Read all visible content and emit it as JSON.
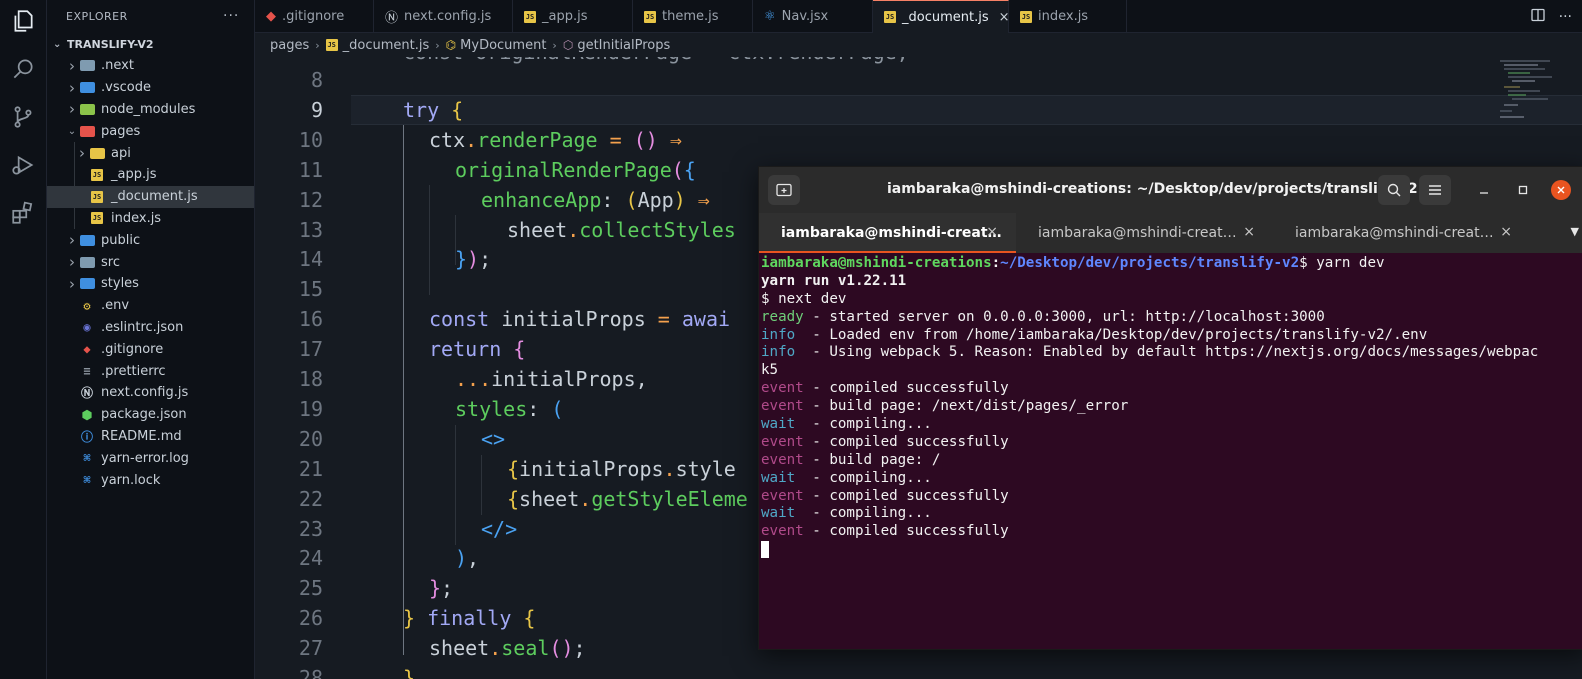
{
  "activity_bar": {
    "icons": [
      "explorer-icon",
      "search-icon",
      "source-control-icon",
      "run-debug-icon",
      "extensions-icon"
    ]
  },
  "sidebar": {
    "title": "EXPLORER",
    "more": "···",
    "project": "TRANSLIFY-V2",
    "items": [
      {
        "label": ".next",
        "type": "folder",
        "color": "#7f9bb0",
        "depth": 0
      },
      {
        "label": ".vscode",
        "type": "folder",
        "color": "#3f8fe0",
        "depth": 0
      },
      {
        "label": "node_modules",
        "type": "folder",
        "color": "#8bc34a",
        "depth": 0
      },
      {
        "label": "pages",
        "type": "folder-open",
        "color": "#e5534b",
        "depth": 0
      },
      {
        "label": "api",
        "type": "folder",
        "color": "#e7c547",
        "depth": 1
      },
      {
        "label": "_app.js",
        "type": "js",
        "depth": 1
      },
      {
        "label": "_document.js",
        "type": "js",
        "depth": 1,
        "selected": true
      },
      {
        "label": "index.js",
        "type": "js",
        "depth": 1
      },
      {
        "label": "public",
        "type": "folder",
        "color": "#3f8fe0",
        "depth": 0
      },
      {
        "label": "src",
        "type": "folder",
        "color": "#7f9bb0",
        "depth": 0
      },
      {
        "label": "styles",
        "type": "folder",
        "color": "#3f8fe0",
        "depth": 0
      },
      {
        "label": ".env",
        "type": "file",
        "icon": "settings-icon",
        "color": "#e7c547",
        "depth": 0
      },
      {
        "label": ".eslintrc.json",
        "type": "file",
        "icon": "eslint-icon",
        "color": "#6a74d6",
        "depth": 0
      },
      {
        "label": ".gitignore",
        "type": "file",
        "icon": "git-icon",
        "color": "#e5534b",
        "depth": 0
      },
      {
        "label": ".prettierrc",
        "type": "file",
        "icon": "prettier-icon",
        "color": "#8b949e",
        "depth": 0
      },
      {
        "label": "next.config.js",
        "type": "file",
        "icon": "nextjs-icon",
        "color": "#c9d1d9",
        "depth": 0
      },
      {
        "label": "package.json",
        "type": "file",
        "icon": "npm-icon",
        "color": "#5dcd5e",
        "depth": 0
      },
      {
        "label": "README.md",
        "type": "file",
        "icon": "info-icon",
        "color": "#3f8fe0",
        "depth": 0
      },
      {
        "label": "yarn-error.log",
        "type": "file",
        "icon": "yarn-icon",
        "color": "#3f8fe0",
        "depth": 0
      },
      {
        "label": "yarn.lock",
        "type": "file",
        "icon": "yarn-icon",
        "color": "#3f8fe0",
        "depth": 0
      }
    ]
  },
  "tabs": [
    {
      "label": ".gitignore",
      "icon": "git-icon"
    },
    {
      "label": "next.config.js",
      "icon": "nextjs-icon"
    },
    {
      "label": "_app.js",
      "icon": "js-icon"
    },
    {
      "label": "theme.js",
      "icon": "js-icon"
    },
    {
      "label": "Nav.jsx",
      "icon": "react-icon"
    },
    {
      "label": "_document.js",
      "icon": "js-icon",
      "active": true,
      "close": "×"
    },
    {
      "label": "index.js",
      "icon": "js-icon"
    }
  ],
  "tab_actions": [
    "split-editor-icon",
    "more-icon"
  ],
  "breadcrumb": [
    "pages",
    "_document.js",
    "MyDocument",
    "getInitialProps"
  ],
  "editor": {
    "top_partial": "const originalRenderPage = ctx.renderPage;",
    "line_numbers": [
      "8",
      "9",
      "10",
      "11",
      "12",
      "13",
      "14",
      "15",
      "16",
      "17",
      "18",
      "19",
      "20",
      "21",
      "22",
      "23",
      "24",
      "25",
      "26",
      "27",
      "28"
    ],
    "current_line": "9",
    "lines": [
      [],
      [
        [
          "kw",
          "try "
        ],
        [
          "br1",
          "{"
        ]
      ],
      [
        [
          "pl",
          "ctx"
        ],
        [
          "op",
          "."
        ],
        [
          "fn",
          "renderPage"
        ],
        [
          "pl",
          " "
        ],
        [
          "op",
          "="
        ],
        [
          "pl",
          " "
        ],
        [
          "br2",
          "()"
        ],
        [
          "pl",
          " "
        ],
        [
          "op",
          "⇒"
        ]
      ],
      [
        [
          "fn",
          "originalRenderPage"
        ],
        [
          "br2",
          "("
        ],
        [
          "br3",
          "{"
        ]
      ],
      [
        [
          "fn",
          "enhanceApp"
        ],
        [
          "pl",
          ": "
        ],
        [
          "br1",
          "("
        ],
        [
          "pl",
          "App"
        ],
        [
          "br1",
          ")"
        ],
        [
          "pl",
          " "
        ],
        [
          "op",
          "⇒"
        ]
      ],
      [
        [
          "pl",
          "sheet"
        ],
        [
          "op",
          "."
        ],
        [
          "fn",
          "collectStyles"
        ]
      ],
      [
        [
          "br3",
          "}"
        ],
        [
          "br2",
          ")"
        ],
        [
          "pl",
          ";"
        ]
      ],
      [],
      [
        [
          "kw",
          "const "
        ],
        [
          "pl",
          "initialProps "
        ],
        [
          "op",
          "="
        ],
        [
          "pl",
          " "
        ],
        [
          "kw",
          "awai"
        ]
      ],
      [
        [
          "kw",
          "return "
        ],
        [
          "br2",
          "{"
        ]
      ],
      [
        [
          "op",
          "..."
        ],
        [
          "pl",
          "initialProps,"
        ]
      ],
      [
        [
          "fn",
          "styles"
        ],
        [
          "pl",
          ": "
        ],
        [
          "br3",
          "("
        ]
      ],
      [
        [
          "tag",
          "<>"
        ]
      ],
      [
        [
          "br1",
          "{"
        ],
        [
          "pl",
          "initialProps"
        ],
        [
          "op",
          "."
        ],
        [
          "pl",
          "style"
        ]
      ],
      [
        [
          "br1",
          "{"
        ],
        [
          "pl",
          "sheet"
        ],
        [
          "op",
          "."
        ],
        [
          "fn",
          "getStyleEleme"
        ]
      ],
      [
        [
          "tag",
          "</>"
        ]
      ],
      [
        [
          "br3",
          ")"
        ],
        [
          "pl",
          ","
        ]
      ],
      [
        [
          "br2",
          "}"
        ],
        [
          "pl",
          ";"
        ]
      ],
      [
        [
          "br1",
          "}"
        ],
        [
          "pl",
          " "
        ],
        [
          "kw",
          "finally "
        ],
        [
          "br1",
          "{"
        ]
      ],
      [
        [
          "pl",
          "sheet"
        ],
        [
          "op",
          "."
        ],
        [
          "fn",
          "seal"
        ],
        [
          "br2",
          "()"
        ],
        [
          "pl",
          ";"
        ]
      ],
      [
        [
          "br1",
          "}"
        ]
      ]
    ]
  },
  "terminal": {
    "title": "iambaraka@mshindi-creations: ~/Desktop/dev/projects/translify-v2",
    "tabs": [
      {
        "label": "iambaraka@mshindi-creat…",
        "close": "×",
        "active": true
      },
      {
        "label": "iambaraka@mshindi-creat…",
        "close": "×"
      },
      {
        "label": "iambaraka@mshindi-creat…",
        "close": "×"
      }
    ],
    "prompt_user": "iambaraka@mshindi-creations",
    "prompt_path": "~/Desktop/dev/projects/translify-v2",
    "prompt_cmd": "$ yarn dev",
    "lines": [
      {
        "prefix": "",
        "prefix_class": "",
        "text": "yarn run v1.22.11",
        "bold": true
      },
      {
        "prefix": "",
        "prefix_class": "",
        "text": "$ next dev"
      },
      {
        "prefix": "ready",
        "prefix_class": "c-ready",
        "text": " - started server on 0.0.0.0:3000, url: http://localhost:3000"
      },
      {
        "prefix": "info ",
        "prefix_class": "c-info",
        "text": " - Loaded env from /home/iambaraka/Desktop/dev/projects/translify-v2/.env"
      },
      {
        "prefix": "info ",
        "prefix_class": "c-info",
        "text": " - Using webpack 5. Reason: Enabled by default https://nextjs.org/docs/messages/webpac"
      },
      {
        "prefix": "",
        "prefix_class": "",
        "text": "k5"
      },
      {
        "prefix": "event",
        "prefix_class": "c-event",
        "text": " - compiled successfully"
      },
      {
        "prefix": "event",
        "prefix_class": "c-event",
        "text": " - build page: /next/dist/pages/_error"
      },
      {
        "prefix": "wait ",
        "prefix_class": "c-wait",
        "text": " - compiling..."
      },
      {
        "prefix": "event",
        "prefix_class": "c-event",
        "text": " - compiled successfully"
      },
      {
        "prefix": "event",
        "prefix_class": "c-event",
        "text": " - build page: /"
      },
      {
        "prefix": "wait ",
        "prefix_class": "c-wait",
        "text": " - compiling..."
      },
      {
        "prefix": "event",
        "prefix_class": "c-event",
        "text": " - compiled successfully"
      },
      {
        "prefix": "wait ",
        "prefix_class": "c-wait",
        "text": " - compiling..."
      },
      {
        "prefix": "event",
        "prefix_class": "c-event",
        "text": " - compiled successfully"
      }
    ]
  },
  "colors": {
    "accent": "#f78166",
    "terminal_bg": "#2d0922",
    "terminal_tab_underline": "#e95420"
  }
}
